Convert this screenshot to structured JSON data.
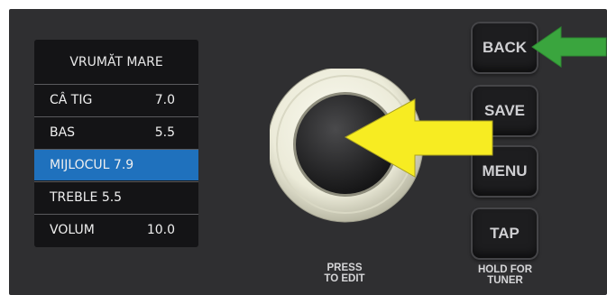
{
  "lcd": {
    "title": "VRUMĂT MARE",
    "rows": [
      {
        "label": "CÂ   TIG",
        "value": "7.0"
      },
      {
        "label": "BAS",
        "value": "5.5"
      },
      {
        "label": "MIJLOCUL 7.9",
        "value": ""
      },
      {
        "label": "TREBLE 5.5",
        "value": ""
      },
      {
        "label": "VOLUM",
        "value": "10.0"
      }
    ],
    "selected_index": 2
  },
  "knob": {
    "caption_line1": "PRESS",
    "caption_line2": "TO EDIT"
  },
  "buttons": {
    "back": "BACK",
    "save": "SAVE",
    "menu": "MENU",
    "tap": "TAP",
    "tap_caption_line1": "HOLD FOR",
    "tap_caption_line2": "TUNER"
  },
  "colors": {
    "panel": "#2f2f31",
    "lcd_bg": "#141416",
    "selection": "#1f71bd",
    "green_arrow": "#3aa53e",
    "yellow_arrow": "#f7ec22"
  }
}
